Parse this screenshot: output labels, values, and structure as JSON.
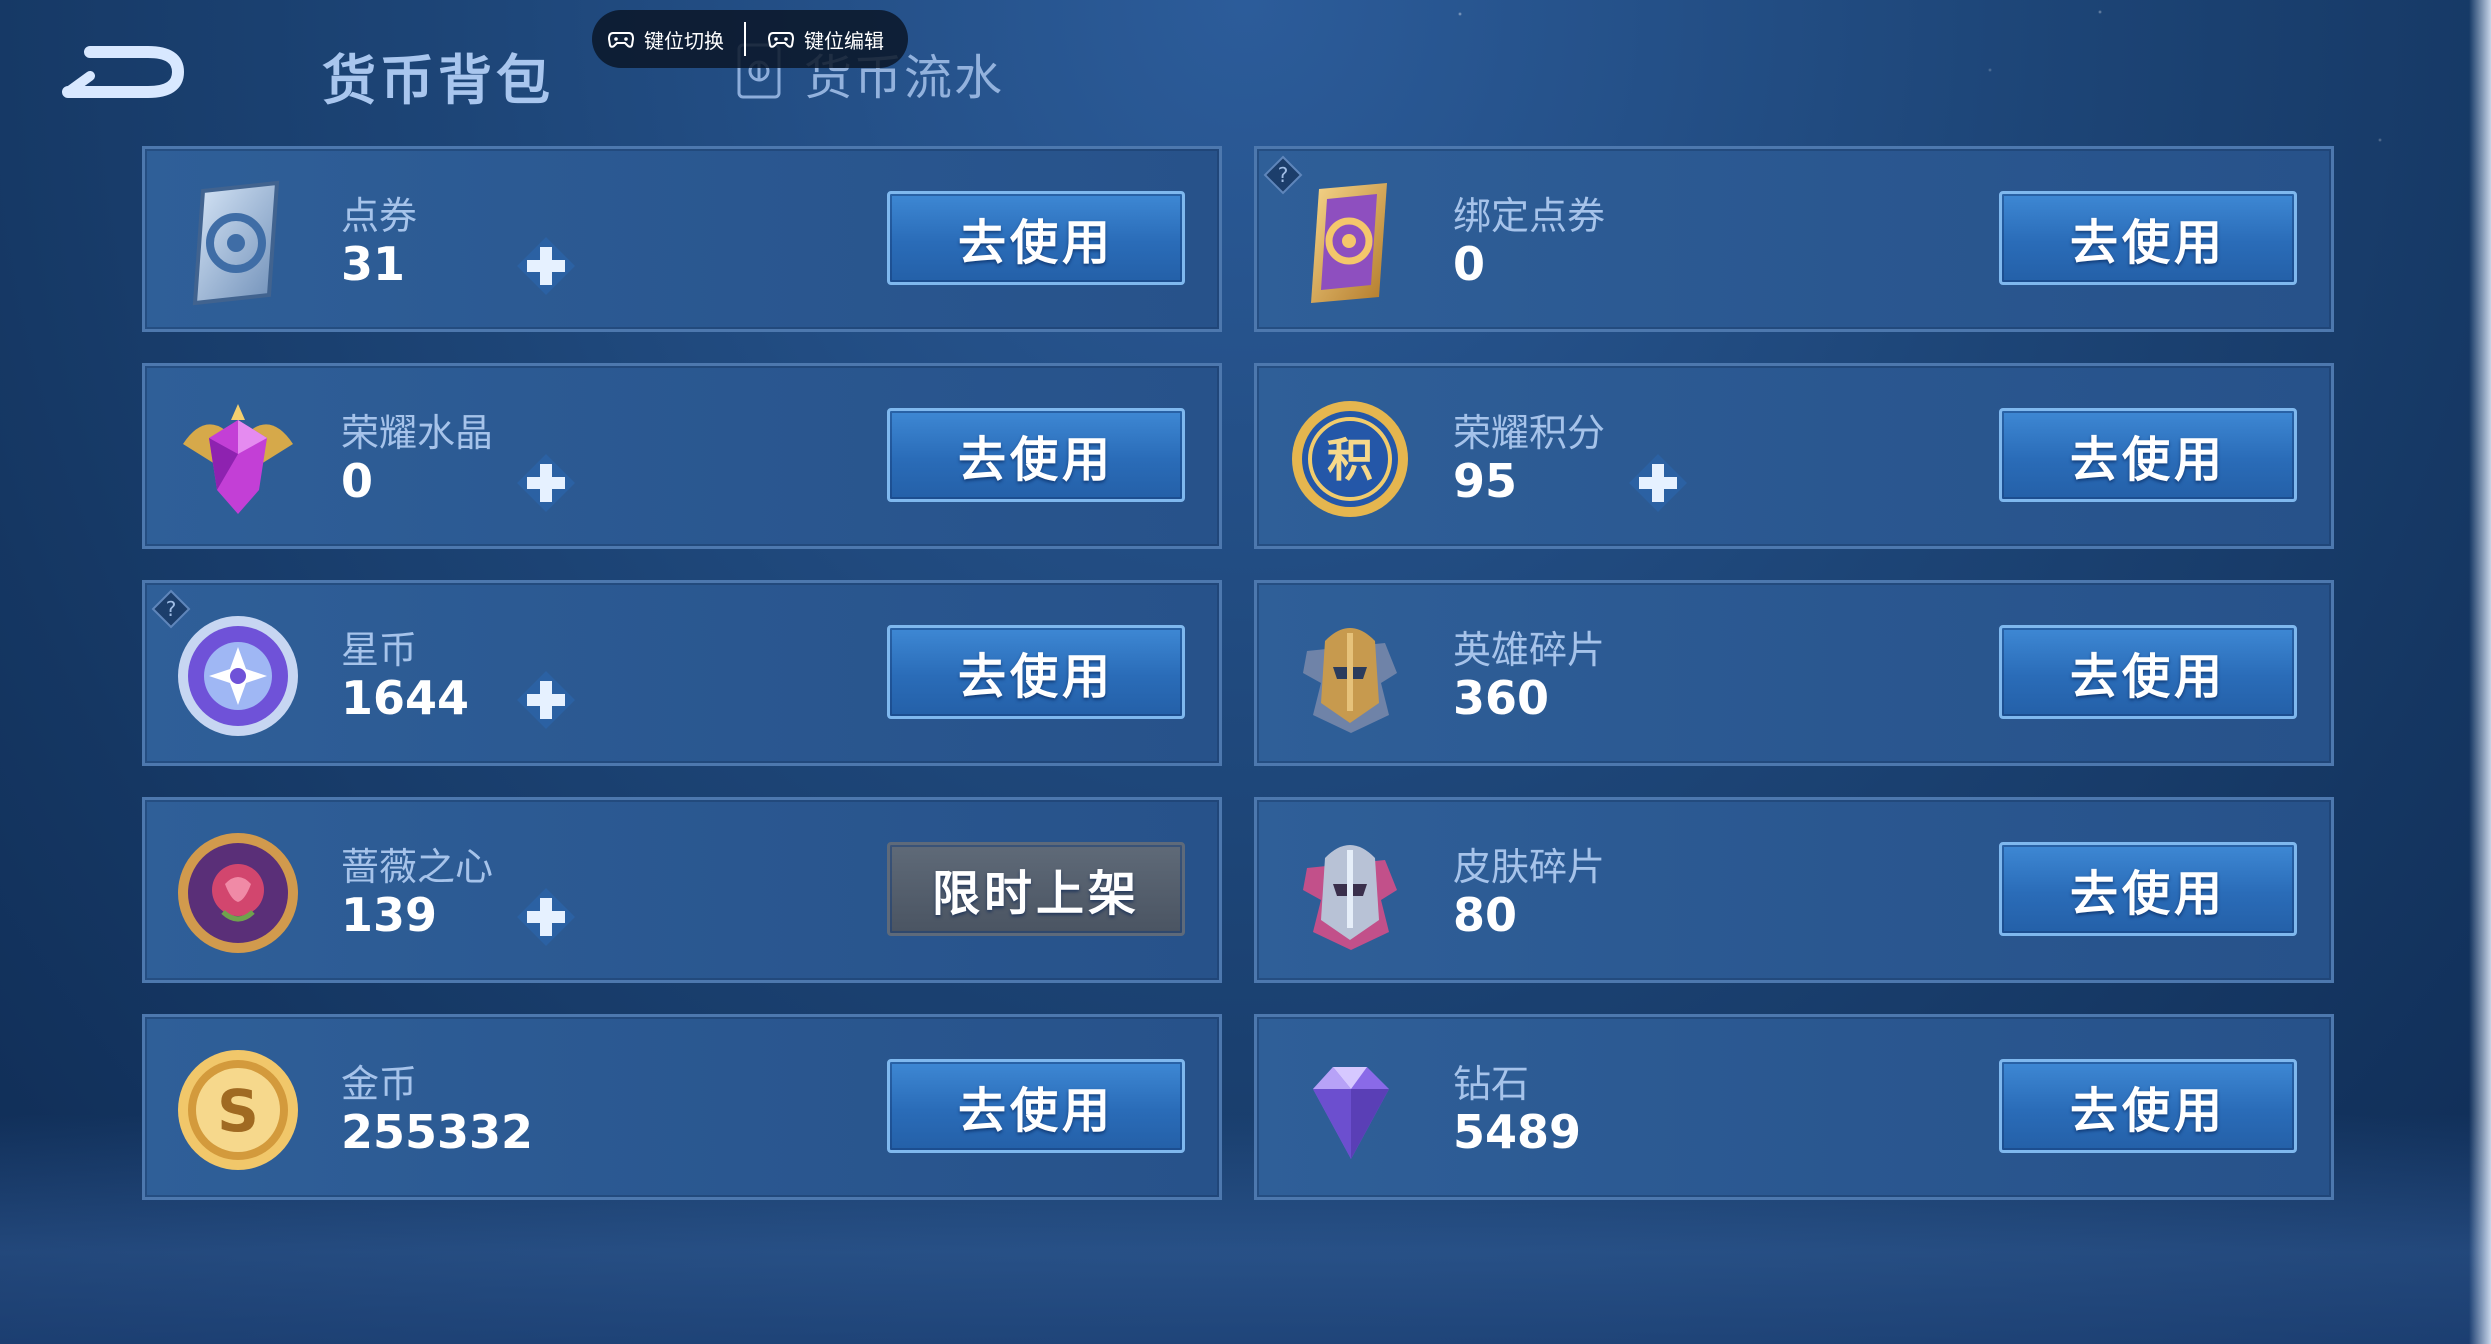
{
  "header": {
    "title": "货币背包",
    "tab_flow": "货币流水"
  },
  "overlay": {
    "switch_label": "键位切换",
    "edit_label": "键位编辑"
  },
  "cards": [
    {
      "name": "点券",
      "count": "31",
      "button": "去使用",
      "icon": "coupon-icon",
      "has_plus": true
    },
    {
      "name": "绑定点券",
      "count": "0",
      "button": "去使用",
      "icon": "bound-coupon-icon",
      "has_plus": false
    },
    {
      "name": "荣耀水晶",
      "count": "0",
      "button": "去使用",
      "icon": "glory-crystal-icon",
      "has_plus": true
    },
    {
      "name": "荣耀积分",
      "count": "95",
      "button": "去使用",
      "icon": "glory-points-icon",
      "has_plus": true
    },
    {
      "name": "星币",
      "count": "1644",
      "button": "去使用",
      "icon": "star-coin-icon",
      "has_plus": true
    },
    {
      "name": "英雄碎片",
      "count": "360",
      "button": "去使用",
      "icon": "hero-fragment-icon",
      "has_plus": false
    },
    {
      "name": "蔷薇之心",
      "count": "139",
      "button": "限时上架",
      "icon": "rose-heart-icon",
      "has_plus": true
    },
    {
      "name": "皮肤碎片",
      "count": "80",
      "button": "去使用",
      "icon": "skin-fragment-icon",
      "has_plus": false
    },
    {
      "name": "金币",
      "count": "255332",
      "button": "去使用",
      "icon": "gold-coin-icon",
      "has_plus": false
    },
    {
      "name": "钻石",
      "count": "5489",
      "button": "去使用",
      "icon": "diamond-icon",
      "has_plus": false
    }
  ],
  "colors": {
    "background": "#1d4577",
    "card": "#2c5a93",
    "button": "#2a6cb8",
    "button_disabled": "#4a5462"
  }
}
